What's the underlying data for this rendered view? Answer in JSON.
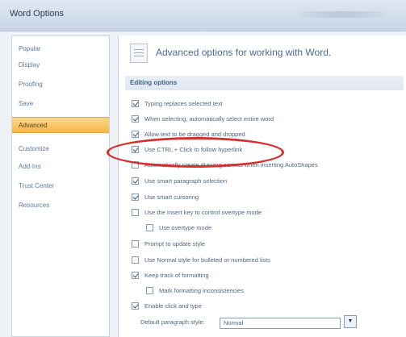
{
  "window": {
    "title": "Word Options"
  },
  "sidebar": {
    "items": [
      {
        "label": "Popular",
        "active": false
      },
      {
        "label": "Display",
        "active": false
      },
      {
        "label": "Proofing",
        "active": false
      },
      {
        "label": "Save",
        "active": false
      },
      {
        "label": "Advanced",
        "active": true
      },
      {
        "label": "Customize",
        "active": false
      },
      {
        "label": "Add-Ins",
        "active": false
      },
      {
        "label": "Trust Center",
        "active": false
      },
      {
        "label": "Resources",
        "active": false
      }
    ]
  },
  "header": {
    "title": "Advanced options for working with Word."
  },
  "editing": {
    "section_title": "Editing options",
    "options": [
      {
        "label": "Typing replaces selected text",
        "checked": true
      },
      {
        "label": "When selecting, automatically select entire word",
        "checked": true
      },
      {
        "label": "Allow text to be dragged and dropped",
        "checked": true
      },
      {
        "label": "Use CTRL + Click to follow hyperlink",
        "checked": true
      },
      {
        "label": "Automatically create drawing canvas when inserting AutoShapes",
        "checked": false
      },
      {
        "label": "Use smart paragraph selection",
        "checked": true
      },
      {
        "label": "Use smart cursoring",
        "checked": true
      },
      {
        "label": "Use the Insert key to control overtype mode",
        "checked": false
      },
      {
        "label": "Use overtype mode",
        "checked": false
      },
      {
        "label": "Prompt to update style",
        "checked": false
      },
      {
        "label": "Use Normal style for bulleted or numbered lists",
        "checked": false
      },
      {
        "label": "Keep track of formatting",
        "checked": true
      },
      {
        "label": "Mark formatting inconsistencies",
        "checked": false
      },
      {
        "label": "Enable click and type",
        "checked": true
      }
    ],
    "default_style_label": "Default paragraph style:",
    "default_style_value": "Normal"
  },
  "icons": {
    "dropdown": "chevron-down-icon",
    "header": "document-options-icon"
  },
  "colors": {
    "accent_active": "#f7b64a",
    "highlight_oval": "#d32f2f"
  }
}
